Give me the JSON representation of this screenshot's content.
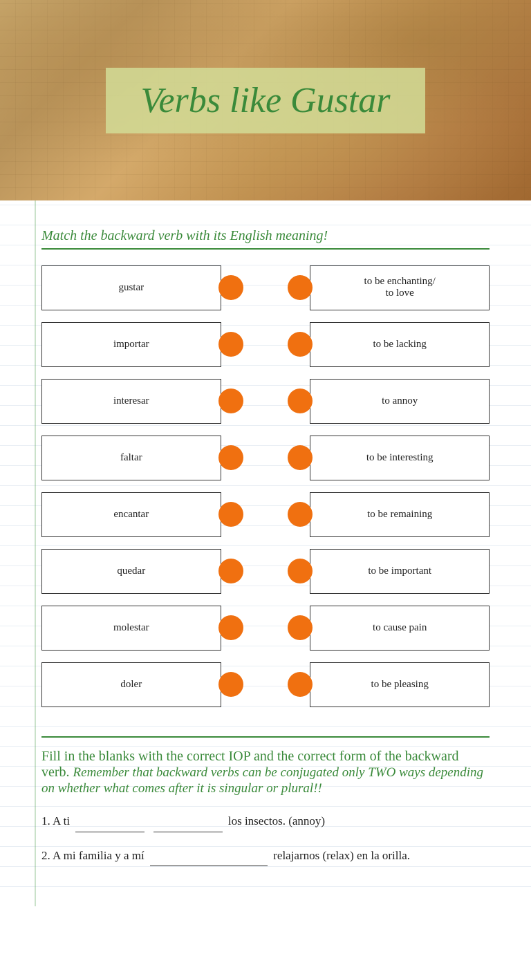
{
  "header": {
    "title": "Verbs like Gustar"
  },
  "section1": {
    "instruction": "Match the backward verb with its English meaning!"
  },
  "left_column": [
    {
      "id": "gustar",
      "label": "gustar"
    },
    {
      "id": "importar",
      "label": "importar"
    },
    {
      "id": "interesar",
      "label": "interesar"
    },
    {
      "id": "faltar",
      "label": "faltar"
    },
    {
      "id": "encantar",
      "label": "encantar"
    },
    {
      "id": "quedar",
      "label": "quedar"
    },
    {
      "id": "molestar",
      "label": "molestar"
    },
    {
      "id": "doler",
      "label": "doler"
    }
  ],
  "right_column": [
    {
      "id": "enchanting",
      "label": "to be enchanting/\nto love"
    },
    {
      "id": "lacking",
      "label": "to be lacking"
    },
    {
      "id": "annoy",
      "label": "to annoy"
    },
    {
      "id": "interesting",
      "label": "to be interesting"
    },
    {
      "id": "remaining",
      "label": "to be remaining"
    },
    {
      "id": "important",
      "label": "to be important"
    },
    {
      "id": "pain",
      "label": "to cause pain"
    },
    {
      "id": "pleasing",
      "label": "to be pleasing"
    }
  ],
  "section2": {
    "instruction_plain": "Fill in the blanks with the correct IOP and the correct form of the backward verb.",
    "instruction_italic": "Remember that backward verbs can be conjugated only TWO ways depending on whether what comes after it is singular or plural!!"
  },
  "exercises": [
    {
      "number": "1.",
      "prefix": "A ti",
      "blank1": true,
      "blank2": true,
      "suffix": "los insectos. (annoy)"
    },
    {
      "number": "2.",
      "prefix": "A mi familia y a mí",
      "blank1": true,
      "suffix": "relajarnos (relax) en la orilla."
    }
  ]
}
